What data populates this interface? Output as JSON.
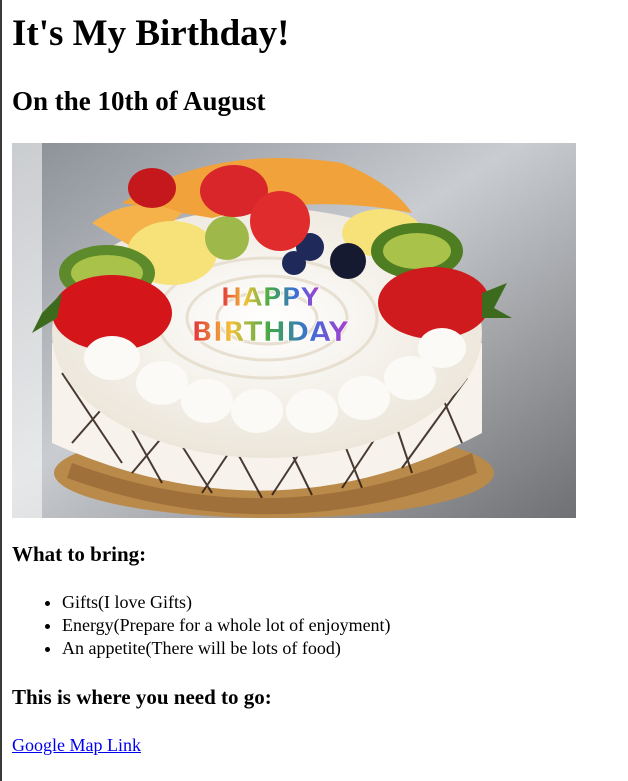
{
  "page": {
    "title": "It's My Birthday!",
    "subtitle": "On the 10th of August"
  },
  "image": {
    "icon": "birthday-cake-photo",
    "overlay_text_line1": "HAPPY",
    "overlay_text_line2": "BIRTHDAY"
  },
  "bring": {
    "heading": "What to bring:",
    "items": [
      "Gifts(I love Gifts)",
      "Energy(Prepare for a whole lot of enjoyment)",
      "An appetite(There will be lots of food)"
    ]
  },
  "directions": {
    "heading": "This is where you need to go:",
    "link_label": "Google Map Link"
  },
  "colors": {
    "link": "#0000ee"
  }
}
